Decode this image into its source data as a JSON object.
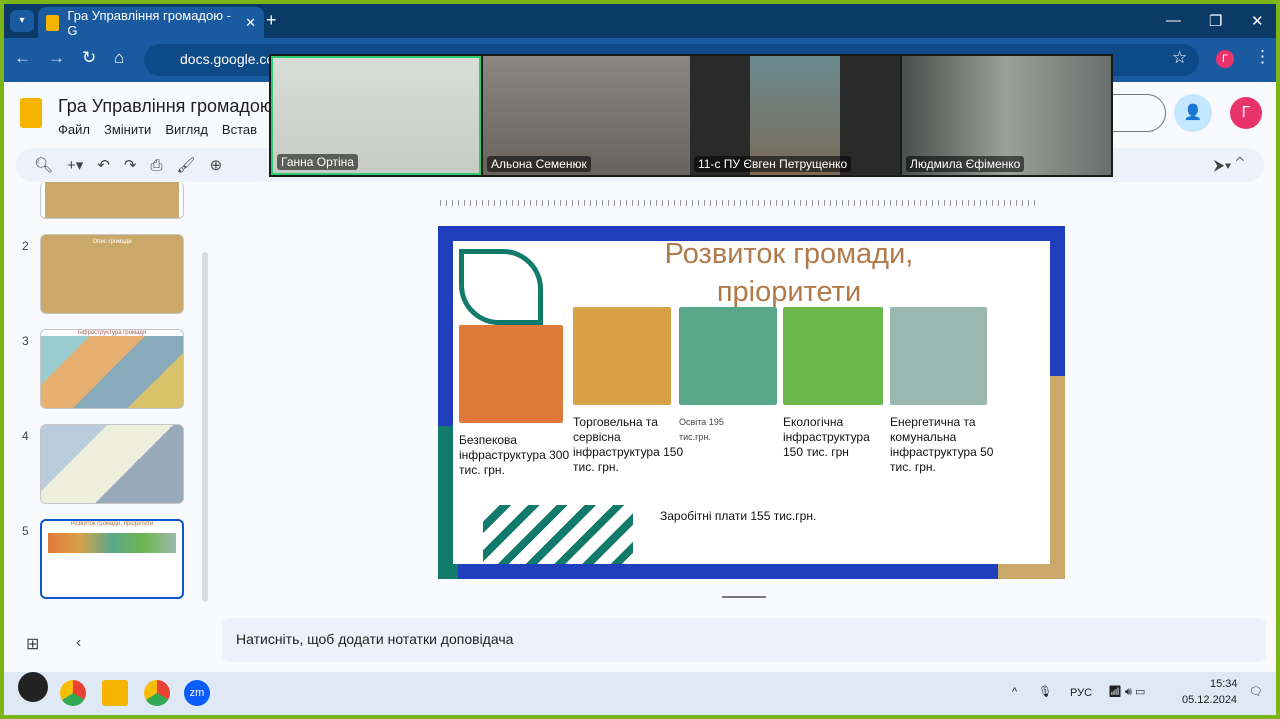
{
  "browser": {
    "tab_title": "Гра Управління громадою - G",
    "url": "docs.google.co",
    "profile_initial": "Г"
  },
  "docs": {
    "title": "Гра Управління громадою",
    "menu": [
      "Файл",
      "Змінити",
      "Вигляд",
      "Встав"
    ],
    "share_initial": "Г"
  },
  "thumbnails": [
    {
      "num": "2",
      "title": "Опис громади"
    },
    {
      "num": "3",
      "title": "Інфраструктура громади"
    },
    {
      "num": "4",
      "title": ""
    },
    {
      "num": "5",
      "title": "Розвиток громади, пріоритети"
    }
  ],
  "slide": {
    "title": "Розвиток громади, пріоритети",
    "items": [
      {
        "caption": "Безпекова інфраструктура 300 тис. грн.",
        "color": "#e07a3a"
      },
      {
        "caption": "Торговельна та сервісна інфраструктура 150 тис. грн.",
        "color": "#d9a04a"
      },
      {
        "caption": "Освіта 195 тис.грн.",
        "color": "#5aa88a"
      },
      {
        "caption": "Екологічна інфраструктура 150 тис. грн",
        "color": "#6cb84e"
      },
      {
        "caption": "Енергетична та комунальна інфраструктура 50 тис. грн.",
        "color": "#9bb8b0"
      }
    ],
    "salary": "Заробітні плати 155 тис.грн."
  },
  "notes_placeholder": "Натисніть, щоб додати нотатки доповідача",
  "zoom": {
    "participants": [
      "Ганна Ортіна",
      "Альона Семенюк",
      "11-с ПУ Євген Петрущенко",
      "Людмила Єфіменко"
    ]
  },
  "taskbar": {
    "lang": "РУС",
    "time": "15:34",
    "date": "05.12.2024",
    "zoom_label": "zm"
  }
}
